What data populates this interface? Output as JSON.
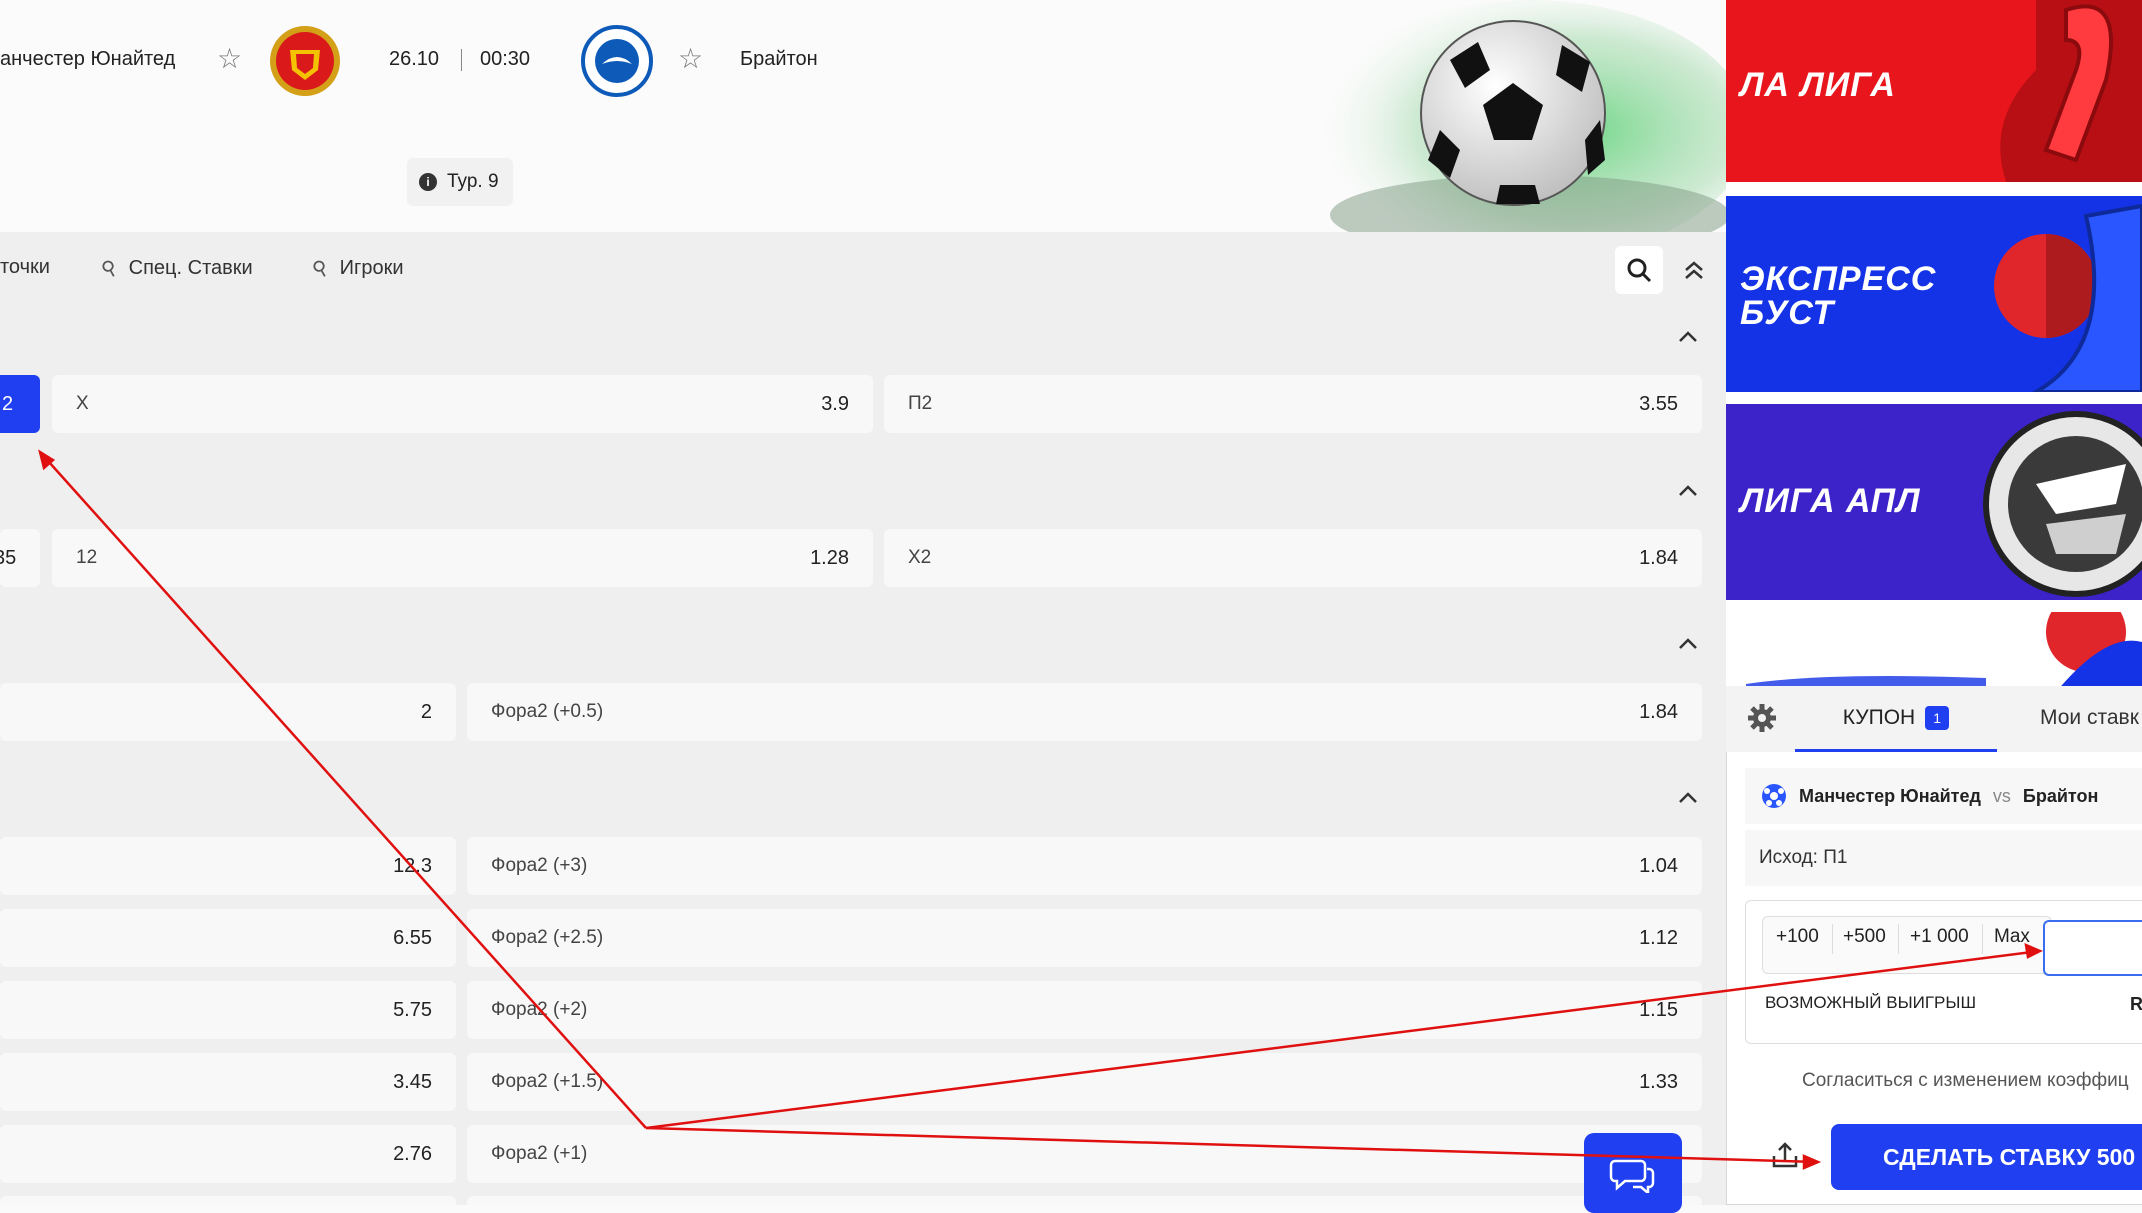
{
  "header": {
    "home_team": "анчестер Юнайтед",
    "away_team": "Брайтон",
    "date": "26.10",
    "time": "00:30",
    "round": "Тур. 9"
  },
  "tabs": {
    "cut_tab": "точки",
    "special": "Спец. Ставки",
    "players": "Игроки"
  },
  "markets": {
    "row1": {
      "selected_value": "2",
      "x_label": "X",
      "x_value": "3.9",
      "p2_label": "П2",
      "p2_value": "3.55"
    },
    "row2": {
      "cut_value": "35",
      "label12": "12",
      "value12": "1.28",
      "x2_label": "Х2",
      "x2_value": "1.84"
    },
    "row3": {
      "left_value": "2",
      "right_label": "Фора2 (+0.5)",
      "right_value": "1.84"
    },
    "handicap": [
      {
        "left_value": "12.3",
        "right_label": "Фора2 (+3)",
        "right_value": "1.04"
      },
      {
        "left_value": "6.55",
        "right_label": "Фора2 (+2.5)",
        "right_value": "1.12"
      },
      {
        "left_value": "5.75",
        "right_label": "Фора2 (+2)",
        "right_value": "1.15"
      },
      {
        "left_value": "3.45",
        "right_label": "Фора2 (+1.5)",
        "right_value": "1.33"
      },
      {
        "left_value": "2.76",
        "right_label": "Фора2 (+1)",
        "right_value": ""
      }
    ]
  },
  "banners": {
    "laliga": "ЛА ЛИГА",
    "express_line1": "ЭКСПРЕСС",
    "express_line2": "БУСТ",
    "apl": "ЛИГА АПЛ"
  },
  "coupon": {
    "tab_label": "КУПОН",
    "count": "1",
    "my_bets": "Мои ставк",
    "home": "Манчестер Юнайтед",
    "vs": "vs",
    "away": "Брайтон",
    "outcome": "Исход: П1",
    "chips": [
      "+100",
      "+500",
      "+1 000",
      "Max"
    ],
    "possible_win": "ВОЗМОЖНЫЙ ВЫИГРЫШ",
    "win_cut": "R",
    "agree": "Согласиться с изменением коэффиц",
    "bet_button": "СДЕЛАТЬ СТАВКУ 500"
  },
  "colors": {
    "accent": "#1f3ff0",
    "annotation": "#e01010",
    "laliga_bg": "#e8161c",
    "express_bg": "#1432e6",
    "apl_bg": "#3b22c9"
  }
}
